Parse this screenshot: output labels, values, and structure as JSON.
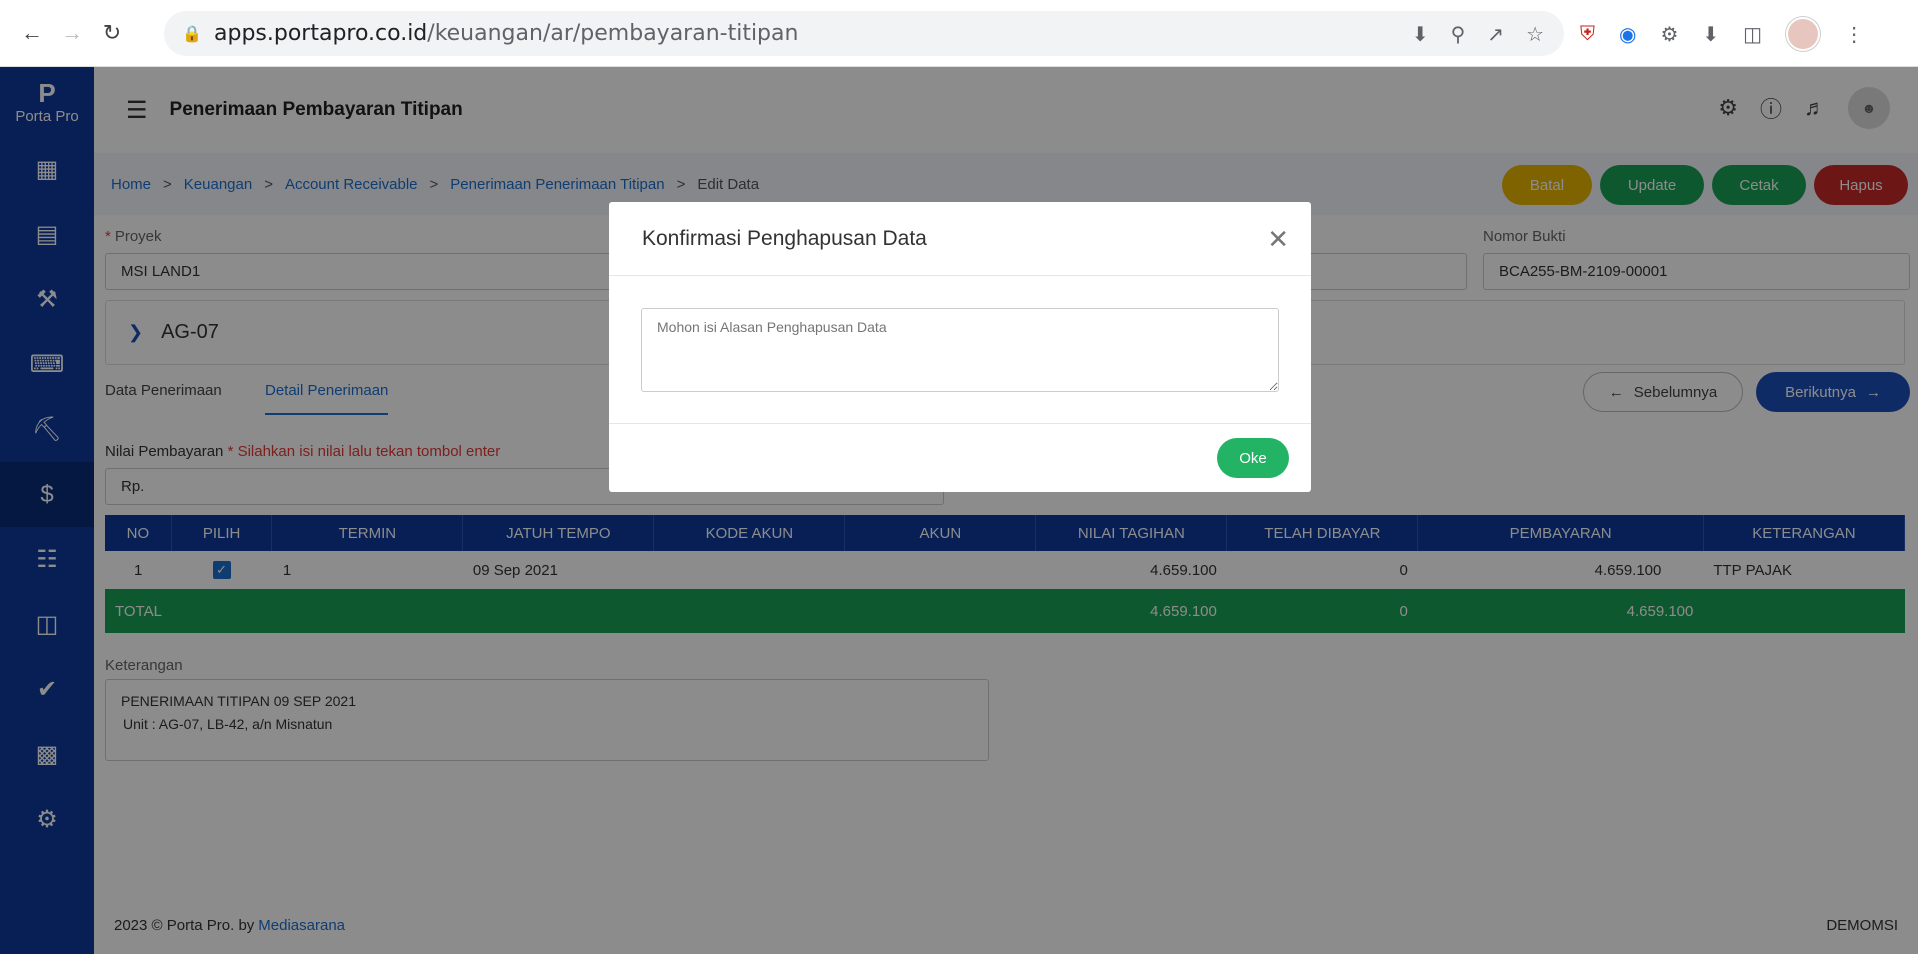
{
  "browser": {
    "url_host": "apps.portapro.co.id",
    "url_path": "/keuangan/ar/pembayaran-titipan"
  },
  "app": {
    "logo_text": "Porta Pro",
    "page_title": "Penerimaan Pembayaran Titipan"
  },
  "breadcrumb": {
    "items": [
      "Home",
      "Keuangan",
      "Account Receivable",
      "Penerimaan Penerimaan Titipan"
    ],
    "current": "Edit Data",
    "separator": ">"
  },
  "actions": {
    "batal": "Batal",
    "update": "Update",
    "cetak": "Cetak",
    "hapus": "Hapus"
  },
  "form": {
    "proyek_label": "Proyek",
    "proyek_value": "MSI LAND1",
    "nomor_bukti_label": "Nomor Bukti",
    "nomor_bukti_value": "BCA255-BM-2109-00001",
    "unit": "AG-07"
  },
  "tabs": {
    "data_penerimaan": "Data Penerimaan",
    "detail_penerimaan": "Detail Penerimaan"
  },
  "pager": {
    "prev": "Sebelumnya",
    "next": "Berikutnya"
  },
  "payment": {
    "label": "Nilai Pembayaran",
    "hint": "Silahkan isi nilai lalu tekan tombol enter",
    "prefix": "Rp."
  },
  "table": {
    "headers": [
      "NO",
      "PILIH",
      "TERMIN",
      "JATUH TEMPO",
      "KODE AKUN",
      "AKUN",
      "NILAI TAGIHAN",
      "TELAH DIBAYAR",
      "PEMBAYARAN",
      "KETERANGAN"
    ],
    "rows": [
      {
        "no": "1",
        "termin": "1",
        "jatuh_tempo": "09 Sep 2021",
        "kode_akun": "",
        "akun": "",
        "nilai_tagihan": "4.659.100",
        "telah_dibayar": "0",
        "pembayaran": "4.659.100",
        "keterangan": "TTP PAJAK"
      }
    ],
    "total": {
      "label": "TOTAL",
      "nilai_tagihan": "4.659.100",
      "telah_dibayar": "0",
      "pembayaran": "4.659.100"
    }
  },
  "keterangan": {
    "label": "Keterangan",
    "line1": "PENERIMAAN TITIPAN 09 SEP 2021",
    "line2": "Unit : AG-07,  LB-42,  a/n Misnatun"
  },
  "footer": {
    "copyright": "2023 © Porta Pro. by",
    "link": "Mediasarana",
    "right": "DEMOMSI"
  },
  "modal": {
    "title": "Konfirmasi Penghapusan Data",
    "placeholder": "Mohon isi Alasan Penghapusan Data",
    "ok": "Oke"
  },
  "colors": {
    "primary": "#0d3a9c",
    "batal": "#e6b400",
    "update": "#1aa156",
    "cetak": "#1aa156",
    "hapus": "#c62828",
    "ok": "#22b464"
  }
}
